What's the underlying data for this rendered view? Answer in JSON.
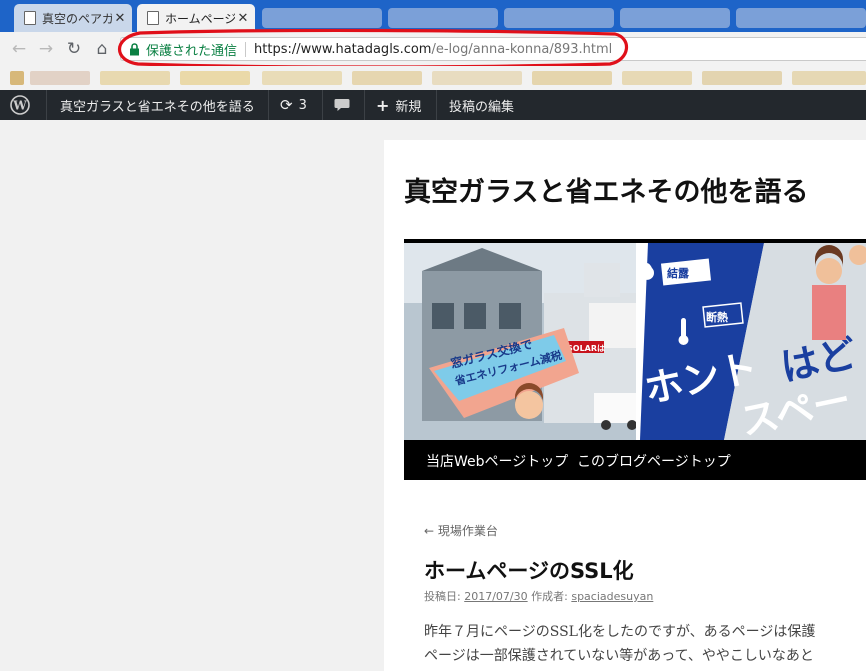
{
  "browser": {
    "tabs": [
      {
        "title": "真空のペアガラス",
        "close": "✕"
      },
      {
        "title": "ホームページのSSL",
        "close": "✕"
      }
    ],
    "address": {
      "security_label": "保護された通信",
      "url_host": "https://www.hatadagls.com",
      "url_path": "/e-log/anna-konna/893.html"
    }
  },
  "wp_admin_bar": {
    "site_name": "真空ガラスと省エネその他を語る",
    "updates_count": "3",
    "new_label": "新規",
    "edit_label": "投稿の編集"
  },
  "page": {
    "site_title": "真空ガラスと省エネその他を語る",
    "banner": {
      "sign_solar": "SOLARは",
      "dew_label": "結露",
      "insulation_label": "断熱",
      "diagonal_line1": "窓ガラス交換で",
      "diagonal_line2": "省エネリフォーム減税",
      "big_text_line1": "ホント",
      "big_text_line1b": "はど",
      "big_text_line2": "スペー"
    },
    "nav": [
      "当店Webページトップ",
      "このブログページトップ"
    ],
    "prev_link": "← 現場作業台",
    "post_title": "ホームページのSSL化",
    "meta": {
      "posted_label": "投稿日:",
      "date": "2017/07/30",
      "author_label": "作成者:",
      "author": "spaciadesuyan"
    },
    "body_lines": [
      "昨年７月にページのSSL化をしたのですが、あるページは保護",
      "ページは一部保護されていない等があって、ややこしいなあと"
    ]
  },
  "colors": {
    "tab_strip": "#1e64c8",
    "secure_green": "#0b8043",
    "highlight_red": "#e0101a",
    "wp_bar": "#23282d",
    "banner_blue": "#1a3fa0"
  }
}
